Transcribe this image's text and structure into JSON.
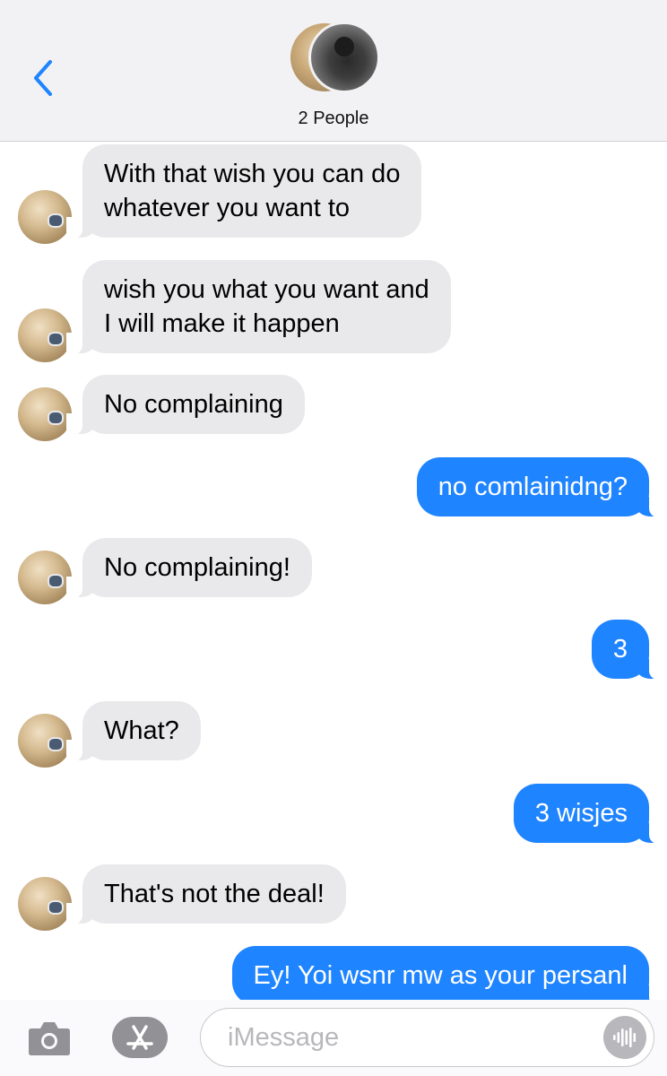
{
  "header": {
    "title": "2 People",
    "back_icon": "chevron-left-icon",
    "accent_color": "#1f84ff"
  },
  "messages": [
    {
      "direction": "incoming",
      "text": "With that wish you can do\nwhatever you want to"
    },
    {
      "direction": "incoming",
      "text": "wish you what you want and\nI will make it happen"
    },
    {
      "direction": "incoming",
      "text": "No complaining"
    },
    {
      "direction": "outgoing",
      "text": "no comlainidng?"
    },
    {
      "direction": "incoming",
      "text": "No complaining!"
    },
    {
      "direction": "outgoing",
      "text": "3"
    },
    {
      "direction": "incoming",
      "text": "What?"
    },
    {
      "direction": "outgoing",
      "text": "3 wisjes"
    },
    {
      "direction": "incoming",
      "text": "That's not the deal!"
    },
    {
      "direction": "outgoing",
      "text": "Ey! Yoi wsnr mw as your persanl"
    }
  ],
  "input_bar": {
    "placeholder": "iMessage",
    "camera_icon": "camera-icon",
    "apps_icon": "app-store-icon",
    "audio_icon": "audio-waveform-icon"
  },
  "colors": {
    "incoming_bubble": "#e9e9eb",
    "outgoing_bubble": "#1f84ff",
    "header_bg": "#f2f2f4"
  }
}
